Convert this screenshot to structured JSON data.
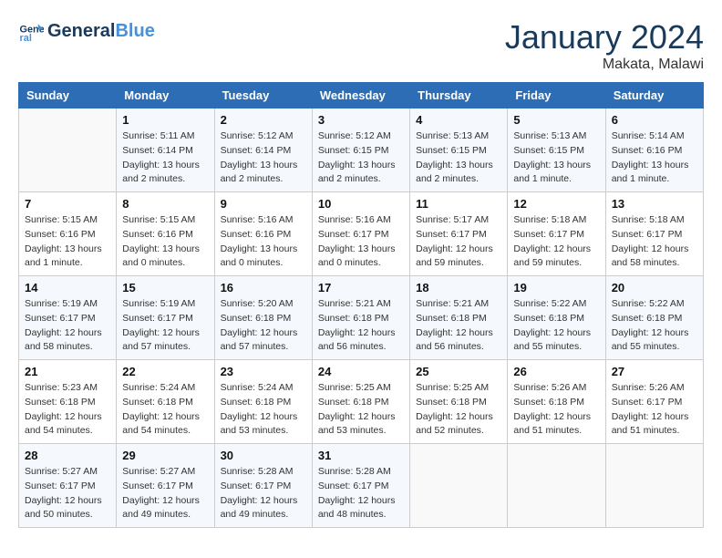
{
  "header": {
    "logo_general": "General",
    "logo_blue": "Blue",
    "month_title": "January 2024",
    "location": "Makata, Malawi"
  },
  "weekdays": [
    "Sunday",
    "Monday",
    "Tuesday",
    "Wednesday",
    "Thursday",
    "Friday",
    "Saturday"
  ],
  "weeks": [
    [
      {
        "day": "",
        "info": ""
      },
      {
        "day": "1",
        "info": "Sunrise: 5:11 AM\nSunset: 6:14 PM\nDaylight: 13 hours\nand 2 minutes."
      },
      {
        "day": "2",
        "info": "Sunrise: 5:12 AM\nSunset: 6:14 PM\nDaylight: 13 hours\nand 2 minutes."
      },
      {
        "day": "3",
        "info": "Sunrise: 5:12 AM\nSunset: 6:15 PM\nDaylight: 13 hours\nand 2 minutes."
      },
      {
        "day": "4",
        "info": "Sunrise: 5:13 AM\nSunset: 6:15 PM\nDaylight: 13 hours\nand 2 minutes."
      },
      {
        "day": "5",
        "info": "Sunrise: 5:13 AM\nSunset: 6:15 PM\nDaylight: 13 hours\nand 1 minute."
      },
      {
        "day": "6",
        "info": "Sunrise: 5:14 AM\nSunset: 6:16 PM\nDaylight: 13 hours\nand 1 minute."
      }
    ],
    [
      {
        "day": "7",
        "info": "Sunrise: 5:15 AM\nSunset: 6:16 PM\nDaylight: 13 hours\nand 1 minute."
      },
      {
        "day": "8",
        "info": "Sunrise: 5:15 AM\nSunset: 6:16 PM\nDaylight: 13 hours\nand 0 minutes."
      },
      {
        "day": "9",
        "info": "Sunrise: 5:16 AM\nSunset: 6:16 PM\nDaylight: 13 hours\nand 0 minutes."
      },
      {
        "day": "10",
        "info": "Sunrise: 5:16 AM\nSunset: 6:17 PM\nDaylight: 13 hours\nand 0 minutes."
      },
      {
        "day": "11",
        "info": "Sunrise: 5:17 AM\nSunset: 6:17 PM\nDaylight: 12 hours\nand 59 minutes."
      },
      {
        "day": "12",
        "info": "Sunrise: 5:18 AM\nSunset: 6:17 PM\nDaylight: 12 hours\nand 59 minutes."
      },
      {
        "day": "13",
        "info": "Sunrise: 5:18 AM\nSunset: 6:17 PM\nDaylight: 12 hours\nand 58 minutes."
      }
    ],
    [
      {
        "day": "14",
        "info": "Sunrise: 5:19 AM\nSunset: 6:17 PM\nDaylight: 12 hours\nand 58 minutes."
      },
      {
        "day": "15",
        "info": "Sunrise: 5:19 AM\nSunset: 6:17 PM\nDaylight: 12 hours\nand 57 minutes."
      },
      {
        "day": "16",
        "info": "Sunrise: 5:20 AM\nSunset: 6:18 PM\nDaylight: 12 hours\nand 57 minutes."
      },
      {
        "day": "17",
        "info": "Sunrise: 5:21 AM\nSunset: 6:18 PM\nDaylight: 12 hours\nand 56 minutes."
      },
      {
        "day": "18",
        "info": "Sunrise: 5:21 AM\nSunset: 6:18 PM\nDaylight: 12 hours\nand 56 minutes."
      },
      {
        "day": "19",
        "info": "Sunrise: 5:22 AM\nSunset: 6:18 PM\nDaylight: 12 hours\nand 55 minutes."
      },
      {
        "day": "20",
        "info": "Sunrise: 5:22 AM\nSunset: 6:18 PM\nDaylight: 12 hours\nand 55 minutes."
      }
    ],
    [
      {
        "day": "21",
        "info": "Sunrise: 5:23 AM\nSunset: 6:18 PM\nDaylight: 12 hours\nand 54 minutes."
      },
      {
        "day": "22",
        "info": "Sunrise: 5:24 AM\nSunset: 6:18 PM\nDaylight: 12 hours\nand 54 minutes."
      },
      {
        "day": "23",
        "info": "Sunrise: 5:24 AM\nSunset: 6:18 PM\nDaylight: 12 hours\nand 53 minutes."
      },
      {
        "day": "24",
        "info": "Sunrise: 5:25 AM\nSunset: 6:18 PM\nDaylight: 12 hours\nand 53 minutes."
      },
      {
        "day": "25",
        "info": "Sunrise: 5:25 AM\nSunset: 6:18 PM\nDaylight: 12 hours\nand 52 minutes."
      },
      {
        "day": "26",
        "info": "Sunrise: 5:26 AM\nSunset: 6:18 PM\nDaylight: 12 hours\nand 51 minutes."
      },
      {
        "day": "27",
        "info": "Sunrise: 5:26 AM\nSunset: 6:17 PM\nDaylight: 12 hours\nand 51 minutes."
      }
    ],
    [
      {
        "day": "28",
        "info": "Sunrise: 5:27 AM\nSunset: 6:17 PM\nDaylight: 12 hours\nand 50 minutes."
      },
      {
        "day": "29",
        "info": "Sunrise: 5:27 AM\nSunset: 6:17 PM\nDaylight: 12 hours\nand 49 minutes."
      },
      {
        "day": "30",
        "info": "Sunrise: 5:28 AM\nSunset: 6:17 PM\nDaylight: 12 hours\nand 49 minutes."
      },
      {
        "day": "31",
        "info": "Sunrise: 5:28 AM\nSunset: 6:17 PM\nDaylight: 12 hours\nand 48 minutes."
      },
      {
        "day": "",
        "info": ""
      },
      {
        "day": "",
        "info": ""
      },
      {
        "day": "",
        "info": ""
      }
    ]
  ]
}
